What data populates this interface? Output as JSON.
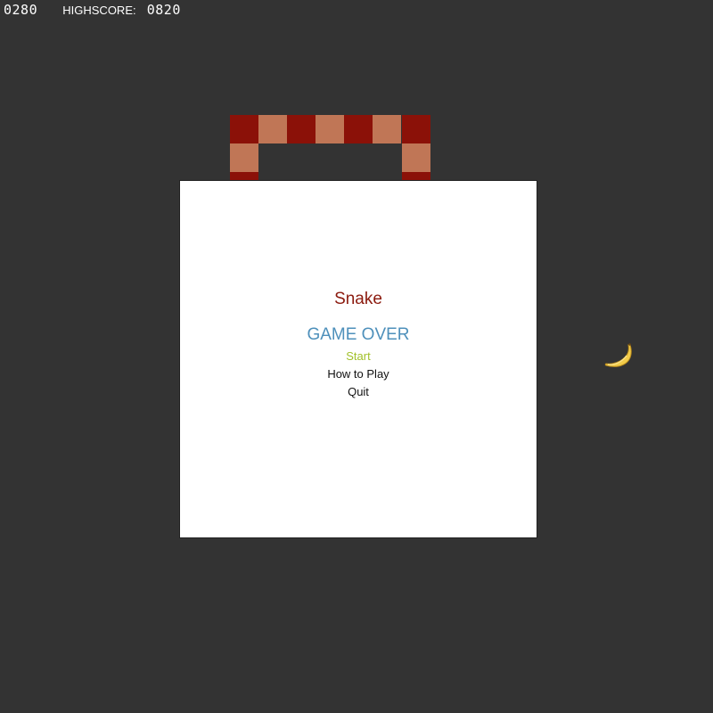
{
  "hud": {
    "score": "0280",
    "highscore_label": "HIGHSCORE:",
    "highscore": "0820"
  },
  "game": {
    "snake_colors": {
      "dark": "#8b1108",
      "light": "#c07656"
    },
    "background_color": "#333333",
    "food_icon": "banana-icon"
  },
  "menu": {
    "title": "Snake",
    "status": "GAME OVER",
    "items": [
      {
        "label": "Start",
        "color": "#a2c12a"
      },
      {
        "label": "How to Play",
        "color": "#111111"
      },
      {
        "label": "Quit",
        "color": "#111111"
      }
    ],
    "title_color": "#8b1a0e",
    "status_color": "#4e90bb"
  }
}
